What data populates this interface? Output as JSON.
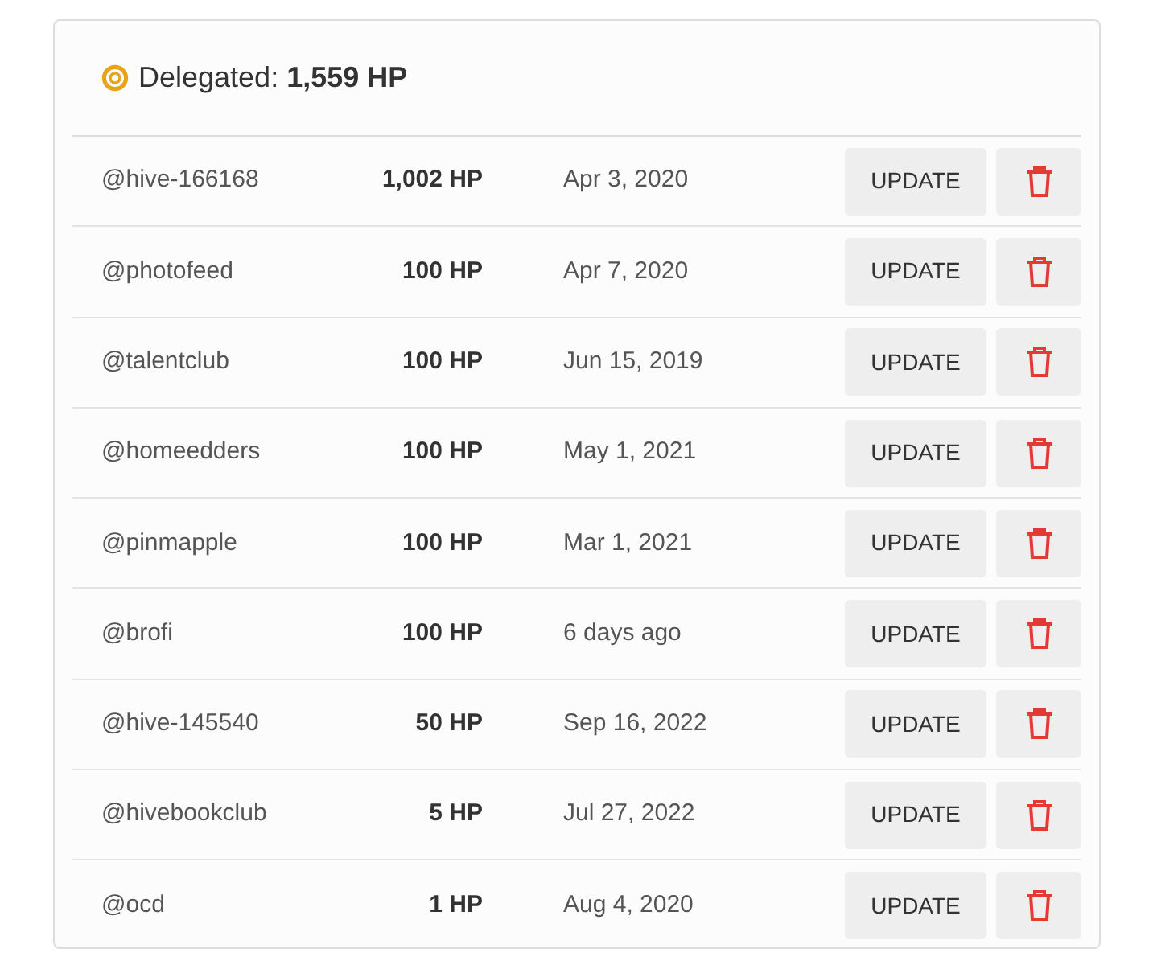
{
  "header": {
    "label": "Delegated: **1,559 HP**"
  },
  "delegations": [
    {
      "account": "@hive-166168",
      "amount": "1,002 HP",
      "date": "Apr 3, 2020",
      "update": "UPDATE"
    },
    {
      "account": "@photofeed",
      "amount": "100 HP",
      "date": "Apr 7, 2020",
      "update": "UPDATE"
    },
    {
      "account": "@talentclub",
      "amount": "100 HP",
      "date": "Jun 15, 2019",
      "update": "UPDATE"
    },
    {
      "account": "@homeedders",
      "amount": "100 HP",
      "date": "May 1, 2021",
      "update": "UPDATE"
    },
    {
      "account": "@pinmapple",
      "amount": "100 HP",
      "date": "Mar 1, 2021",
      "update": "UPDATE"
    },
    {
      "account": "@brofi",
      "amount": "100 HP",
      "date": "6 days ago",
      "update": "UPDATE"
    },
    {
      "account": "@hive-145540",
      "amount": "50 HP",
      "date": "Sep 16, 2022",
      "update": "UPDATE"
    },
    {
      "account": "@hivebookclub",
      "amount": "5 HP",
      "date": "Jul 27, 2022",
      "update": "UPDATE"
    },
    {
      "account": "@ocd",
      "amount": "1 HP",
      "date": "Aug 4, 2020",
      "update": "UPDATE"
    }
  ]
}
